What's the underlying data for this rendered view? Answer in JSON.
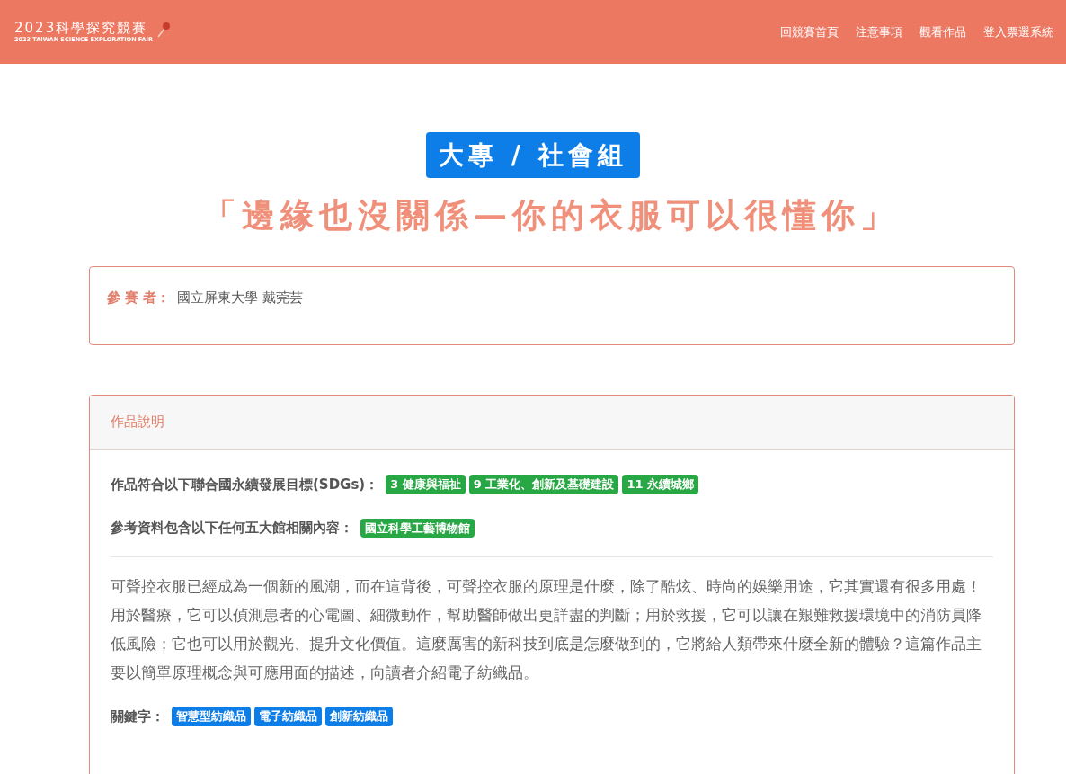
{
  "header": {
    "logo": {
      "title": "2023科學探究競賽",
      "subtitle": "2023 TAIWAN SCIENCE EXPLORATION FAIR"
    },
    "nav": [
      "回競賽首頁",
      "注意事項",
      "觀看作品",
      "登入票選系統"
    ]
  },
  "group_badge": "大專 / 社會組",
  "work_title": "「邊緣也沒關係—你的衣服可以很懂你」",
  "participant": {
    "label": "參 賽 者：",
    "value": "國立屏東大學 戴莞芸"
  },
  "description": {
    "heading": "作品說明",
    "sdgs": {
      "label": "作品符合以下聯合國永續發展目標(SDGs)：",
      "tags": [
        "3 健康與福祉",
        "9 工業化、創新及基礎建設",
        "11 永續城鄉"
      ]
    },
    "museums": {
      "label": "參考資料包含以下任何五大館相關內容：",
      "tags": [
        "國立科學工藝博物館"
      ]
    },
    "body": "可聲控衣服已經成為一個新的風潮，而在這背後，可聲控衣服的原理是什麼，除了酷炫、時尚的娛樂用途，它其實還有很多用處！用於醫療，它可以偵測患者的心電圖、細微動作，幫助醫師做出更詳盡的判斷；用於救援，它可以讓在艱難救援環境中的消防員降低風險；它也可以用於觀光、提升文化價值。這麼厲害的新科技到底是怎麼做到的，它將給人類帶來什麼全新的體驗？這篇作品主要以簡單原理概念與可應用面的描述，向讀者介紹電子紡織品。",
    "keywords": {
      "label": "關鍵字：",
      "tags": [
        "智慧型紡織品",
        "電子紡織品",
        "創新紡織品"
      ]
    }
  }
}
